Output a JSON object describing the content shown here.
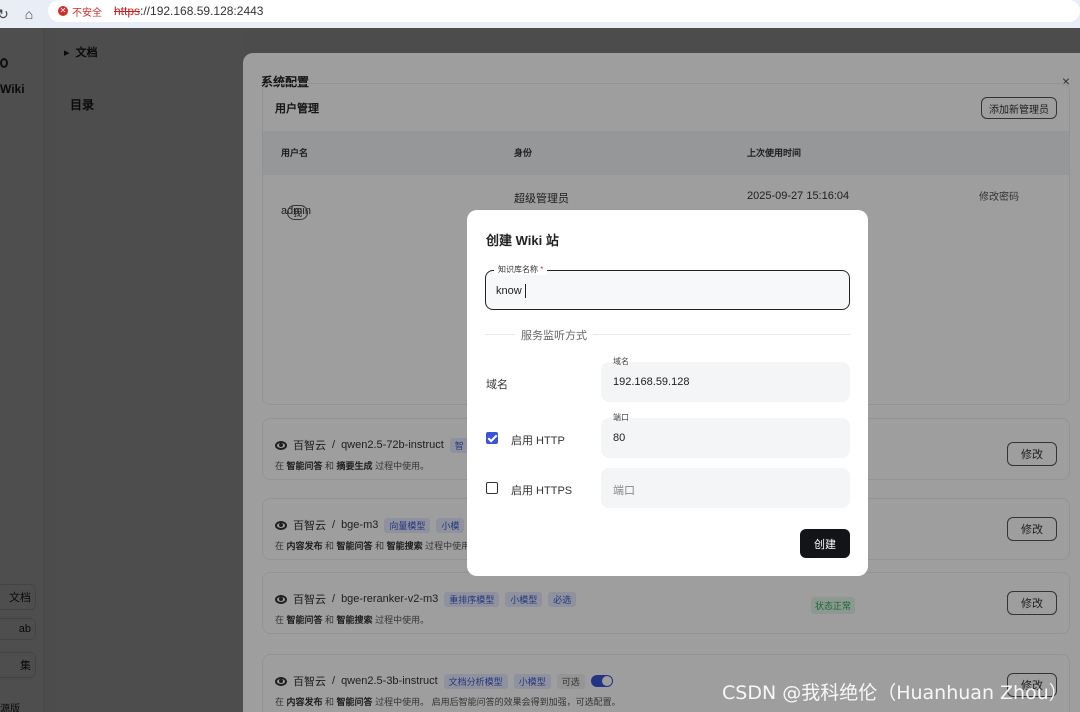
{
  "browser": {
    "insecure_label": "不安全",
    "url_scheme": "https",
    "url_rest": "://192.168.59.128:2443"
  },
  "sidebar": {
    "logo_text": "Wiki",
    "bottom_items": [
      "文档",
      "ab",
      "集"
    ],
    "footer_item": "源版"
  },
  "doc_panel": {
    "docs_label": "文档",
    "toc_label": "目录"
  },
  "system_config": {
    "title": "系统配置",
    "user_management": {
      "title": "用户管理",
      "add_admin_button": "添加新管理员",
      "columns": [
        "用户名",
        "身份",
        "上次使用时间"
      ],
      "rows": [
        {
          "username": "admin",
          "me_badge": "我",
          "role": "超级管理员",
          "last_used": "2025-09-27 15:16:04",
          "action": "修改密码"
        }
      ]
    },
    "models": [
      {
        "provider": "百智云",
        "name": "qwen2.5-72b-instruct",
        "tags": [
          "智"
        ],
        "desc_parts": [
          "在 ",
          "智能问答",
          " 和 ",
          "摘要生成",
          " 过程中使用。"
        ],
        "action": "修改"
      },
      {
        "provider": "百智云",
        "name": "bge-m3",
        "tags": [
          "向量模型",
          "小模"
        ],
        "desc_parts": [
          "在 ",
          "内容发布",
          " 和 ",
          "智能问答",
          " 和 ",
          "智能搜索",
          " 过程中使用"
        ],
        "action": "修改"
      },
      {
        "provider": "百智云",
        "name": "bge-reranker-v2-m3",
        "tags": [
          "重排序模型",
          "小模型",
          "必选"
        ],
        "desc_parts": [
          "在 ",
          "智能问答",
          " 和 ",
          "智能搜索",
          " 过程中使用。"
        ],
        "status": "状态正常",
        "action": "修改"
      },
      {
        "provider": "百智云",
        "name": "qwen2.5-3b-instruct",
        "tags": [
          "文档分析模型",
          "小模型",
          "可选"
        ],
        "desc_parts": [
          "在 ",
          "内容发布",
          " 和 ",
          "智能问答",
          " 过程中使用。 启用后智能问答的效果会得到加强，可选配置。"
        ],
        "action": "修改"
      }
    ]
  },
  "create_wiki": {
    "title": "创建 Wiki 站",
    "name_label": "知识库名称",
    "required_mark": "*",
    "name_value": "know",
    "section_title": "服务监听方式",
    "domain_label": "域名",
    "domain_small_label": "域名",
    "domain_value": "192.168.59.128",
    "http_label": "启用 HTTP",
    "http_checked": true,
    "http_port_label": "端口",
    "http_port_value": "80",
    "https_label": "启用 HTTPS",
    "https_checked": false,
    "https_port_placeholder": "端口",
    "create_button": "创建"
  },
  "watermark": "CSDN @我科绝伦（Huanhuan Zhou）",
  "colors": {
    "accent": "#3b55d6",
    "primary_button": "#121417",
    "insecure_red": "#d12c2c"
  }
}
